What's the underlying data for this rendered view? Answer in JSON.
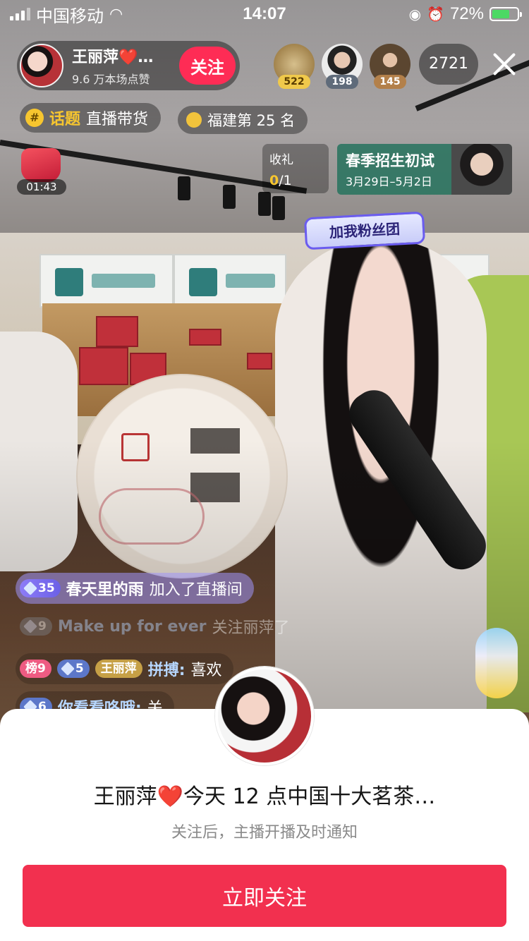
{
  "status_bar": {
    "carrier": "中国移动",
    "time": "14:07",
    "battery_percent": "72%",
    "battery_level": 0.72
  },
  "host": {
    "name": "王丽萍❤️…",
    "likes": "9.6 万本场点赞",
    "follow_label": "关注"
  },
  "top_viewers": [
    {
      "score": "522"
    },
    {
      "score": "198"
    },
    {
      "score": "145"
    }
  ],
  "viewer_count": "2721",
  "topic": {
    "tag": "话题",
    "label": "直播带货",
    "hash_symbol": "#"
  },
  "rank": {
    "label": "福建第 25 名"
  },
  "gift_timer": "01:43",
  "gift_task": {
    "title": "收礼",
    "current": "0",
    "total": "/1"
  },
  "promo": {
    "title": "春季招生初试",
    "dates": "3月29日–5月2日"
  },
  "fans_sticker": "加我粉丝团",
  "comments": [
    {
      "level": "35",
      "user": "春天里的雨",
      "text": "加入了直播间"
    },
    {
      "level": "9",
      "user": "Make up for ever",
      "text": "关注丽萍了"
    },
    {
      "rank_badge": "榜9",
      "level": "5",
      "fan_club": "王丽萍",
      "user": "拼搏:",
      "text": "喜欢"
    },
    {
      "level": "6",
      "user": "你看看咯哦:",
      "text": "关"
    }
  ],
  "sheet": {
    "title": "王丽萍❤️今天 12 点中国十大茗茶…",
    "subtitle": "关注后，主播开播及时通知",
    "button_label": "立即关注"
  },
  "colors": {
    "accent": "#fe2c55",
    "sheet_button": "#f2304f",
    "gold": "#f7c62f"
  }
}
